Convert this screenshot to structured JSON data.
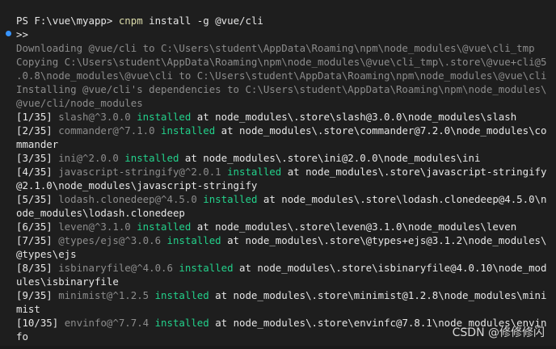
{
  "prompt": {
    "prefix": "PS F:\\vue\\myapp> ",
    "command": "cnpm",
    "args": " install -g @vue/cli",
    "continuation": ">>"
  },
  "plain_lines": [
    "Downloading @vue/cli to C:\\Users\\student\\AppData\\Roaming\\npm\\node_modules\\@vue\\cli_tmp",
    "Copying C:\\Users\\student\\AppData\\Roaming\\npm\\node_modules\\@vue\\cli_tmp\\.store\\@vue+cli@5",
    ".0.8\\node_modules\\@vue\\cli to C:\\Users\\student\\AppData\\Roaming\\npm\\node_modules\\@vue\\cli",
    "Installing @vue/cli's dependencies to C:\\Users\\student\\AppData\\Roaming\\npm\\node_modules\\",
    "@vue/cli/node_modules"
  ],
  "installs": [
    {
      "counter": "[1/35] ",
      "pkg": "slash@^3.0.0 ",
      "status": "installed",
      "rest": [
        " at node_modules\\.store\\slash@3.0.0\\node_modules\\slash"
      ]
    },
    {
      "counter": "[2/35] ",
      "pkg": "commander@^7.1.0 ",
      "status": "installed",
      "rest": [
        " at node_modules\\.store\\commander@7.2.0\\node_modules\\co",
        "mmander"
      ]
    },
    {
      "counter": "[3/35] ",
      "pkg": "ini@^2.0.0 ",
      "status": "installed",
      "rest": [
        " at node_modules\\.store\\ini@2.0.0\\node_modules\\ini"
      ]
    },
    {
      "counter": "[4/35] ",
      "pkg": "javascript-stringify@^2.0.1 ",
      "status": "installed",
      "rest": [
        " at node_modules\\.store\\javascript-stringify",
        "@2.1.0\\node_modules\\javascript-stringify"
      ]
    },
    {
      "counter": "[5/35] ",
      "pkg": "lodash.clonedeep@^4.5.0 ",
      "status": "installed",
      "rest": [
        " at node_modules\\.store\\lodash.clonedeep@4.5.0\\n",
        "ode_modules\\lodash.clonedeep"
      ]
    },
    {
      "counter": "[6/35] ",
      "pkg": "leven@^3.1.0 ",
      "status": "installed",
      "rest": [
        " at node_modules\\.store\\leven@3.1.0\\node_modules\\leven"
      ]
    },
    {
      "counter": "[7/35] ",
      "pkg": "@types/ejs@^3.0.6 ",
      "status": "installed",
      "rest": [
        " at node_modules\\.store\\@types+ejs@3.1.2\\node_modules\\",
        "@types\\ejs"
      ]
    },
    {
      "counter": "[8/35] ",
      "pkg": "isbinaryfile@^4.0.6 ",
      "status": "installed",
      "rest": [
        " at node_modules\\.store\\isbinaryfile@4.0.10\\node_mod",
        "ules\\isbinaryfile"
      ]
    },
    {
      "counter": "[9/35] ",
      "pkg": "minimist@^1.2.5 ",
      "status": "installed",
      "rest": [
        " at node_modules\\.store\\minimist@1.2.8\\node_modules\\mini",
        "mist"
      ]
    },
    {
      "counter": "[10/35] ",
      "pkg": "envinfo@^7.7.4 ",
      "status": "installed",
      "rest": [
        " at node_modules\\.store\\envinfc@7.8.1\\node_modules\\envin",
        "fo"
      ]
    }
  ],
  "watermark": "CSDN @修修修闪",
  "colors": {
    "background": "#1e1e1e",
    "installed": "#23d18b",
    "command": "#dcdcaa",
    "dim": "#8c8c8c",
    "prompt_dot": "#3794ff"
  }
}
